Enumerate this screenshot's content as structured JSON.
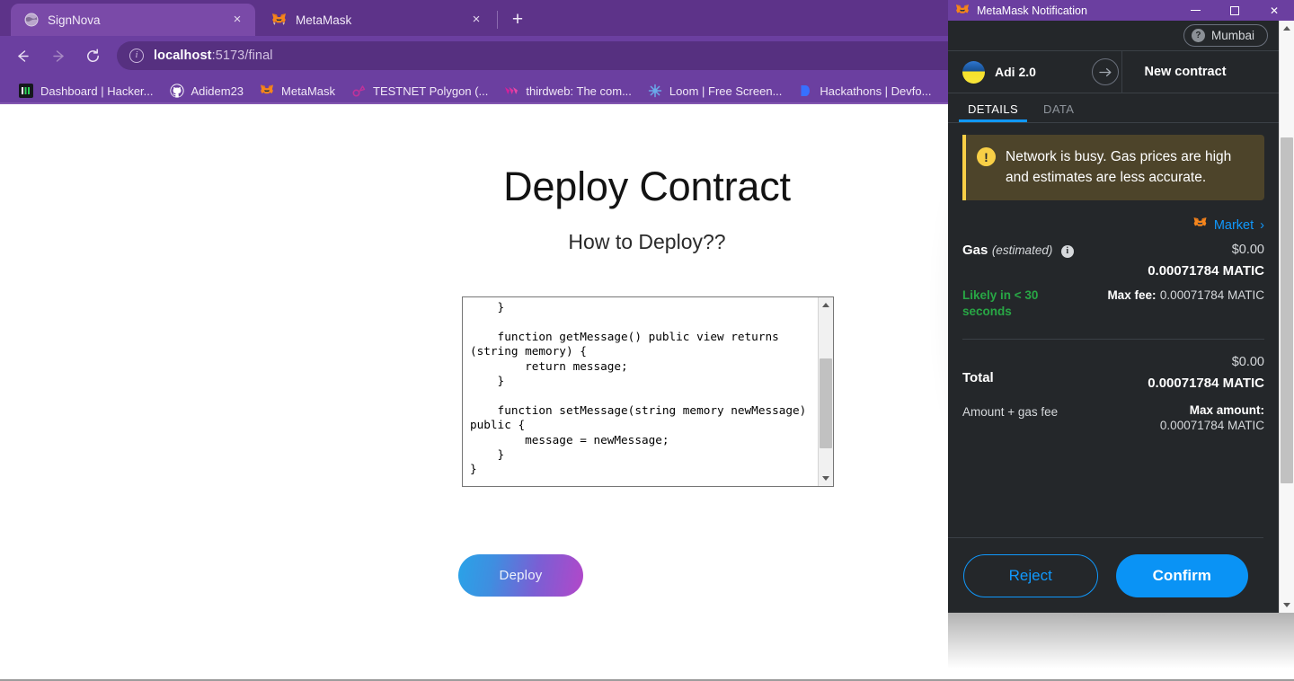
{
  "browser": {
    "tabs": [
      {
        "title": "SignNova",
        "icon": "globe-icon",
        "active": true,
        "close": "×"
      },
      {
        "title": "MetaMask",
        "icon": "metamask-fox-icon",
        "active": false,
        "close": "×"
      }
    ],
    "new_tab_label": "+",
    "nav": {
      "back": "←",
      "forward": "→",
      "reload": "⟳"
    },
    "omnibox": {
      "host": "localhost",
      "path": ":5173/final",
      "full_url": "localhost:5173/final",
      "site_info_icon": "info-circle-icon"
    },
    "bookmarks": [
      {
        "label": "Dashboard | Hacker...",
        "icon": "hackerearth-icon"
      },
      {
        "label": "Adidem23",
        "icon": "github-icon"
      },
      {
        "label": "MetaMask",
        "icon": "metamask-fox-icon"
      },
      {
        "label": "TESTNET Polygon (...",
        "icon": "polygon-icon"
      },
      {
        "label": "thirdweb: The com...",
        "icon": "thirdweb-icon"
      },
      {
        "label": "Loom | Free Screen...",
        "icon": "loom-icon"
      },
      {
        "label": "Hackathons | Devfo...",
        "icon": "devfolio-icon"
      }
    ],
    "colors": {
      "chrome": "#6b3fa0",
      "tabstrip": "#5d3389",
      "active_tab": "#7a4aa8",
      "omnibox": "#563080"
    }
  },
  "page": {
    "title": "Deploy Contract",
    "subtitle": "How to Deploy??",
    "code": "    }\n\n    function getMessage() public view returns\n(string memory) {\n        return message;\n    }\n\n    function setMessage(string memory newMessage)\npublic {\n        message = newMessage;\n    }\n}",
    "deploy_button": "Deploy",
    "deploy_gradient_from": "#29a3e8",
    "deploy_gradient_to": "#b347c9"
  },
  "metamask": {
    "window_title": "MetaMask Notification",
    "window_controls": {
      "minimize": "—",
      "maximize": "□",
      "close": "✕"
    },
    "network": {
      "name": "Mumbai",
      "icon": "question-mark-icon"
    },
    "transfer": {
      "from_account": "Adi 2.0",
      "arrow": "→",
      "to_account": "New contract"
    },
    "tabs": [
      {
        "label": "DETAILS",
        "active": true
      },
      {
        "label": "DATA",
        "active": false
      }
    ],
    "warning": {
      "icon": "exclamation-icon",
      "text": "Network is busy. Gas prices are high and estimates are less accurate."
    },
    "market": {
      "label": "Market",
      "chevron": "›",
      "icon": "metamask-fox-icon"
    },
    "gas": {
      "label": "Gas",
      "estimated": "(estimated)",
      "info_icon": "info-icon",
      "fiat": "$0.00",
      "crypto": "0.00071784 MATIC",
      "speed": "Likely in < 30 seconds",
      "max_fee_label": "Max fee:",
      "max_fee_value": "0.00071784 MATIC"
    },
    "total": {
      "label": "Total",
      "fiat": "$0.00",
      "crypto": "0.00071784 MATIC",
      "description": "Amount + gas fee",
      "max_amount_label": "Max amount:",
      "max_amount_value": "0.00071784 MATIC"
    },
    "actions": {
      "reject": "Reject",
      "confirm": "Confirm"
    },
    "colors": {
      "background": "#24272a",
      "accent": "#1098fc",
      "confirm": "#0a93f5",
      "warning_bg": "#4d442a",
      "warning_border": "#f8cf46",
      "success": "#28a745"
    }
  }
}
